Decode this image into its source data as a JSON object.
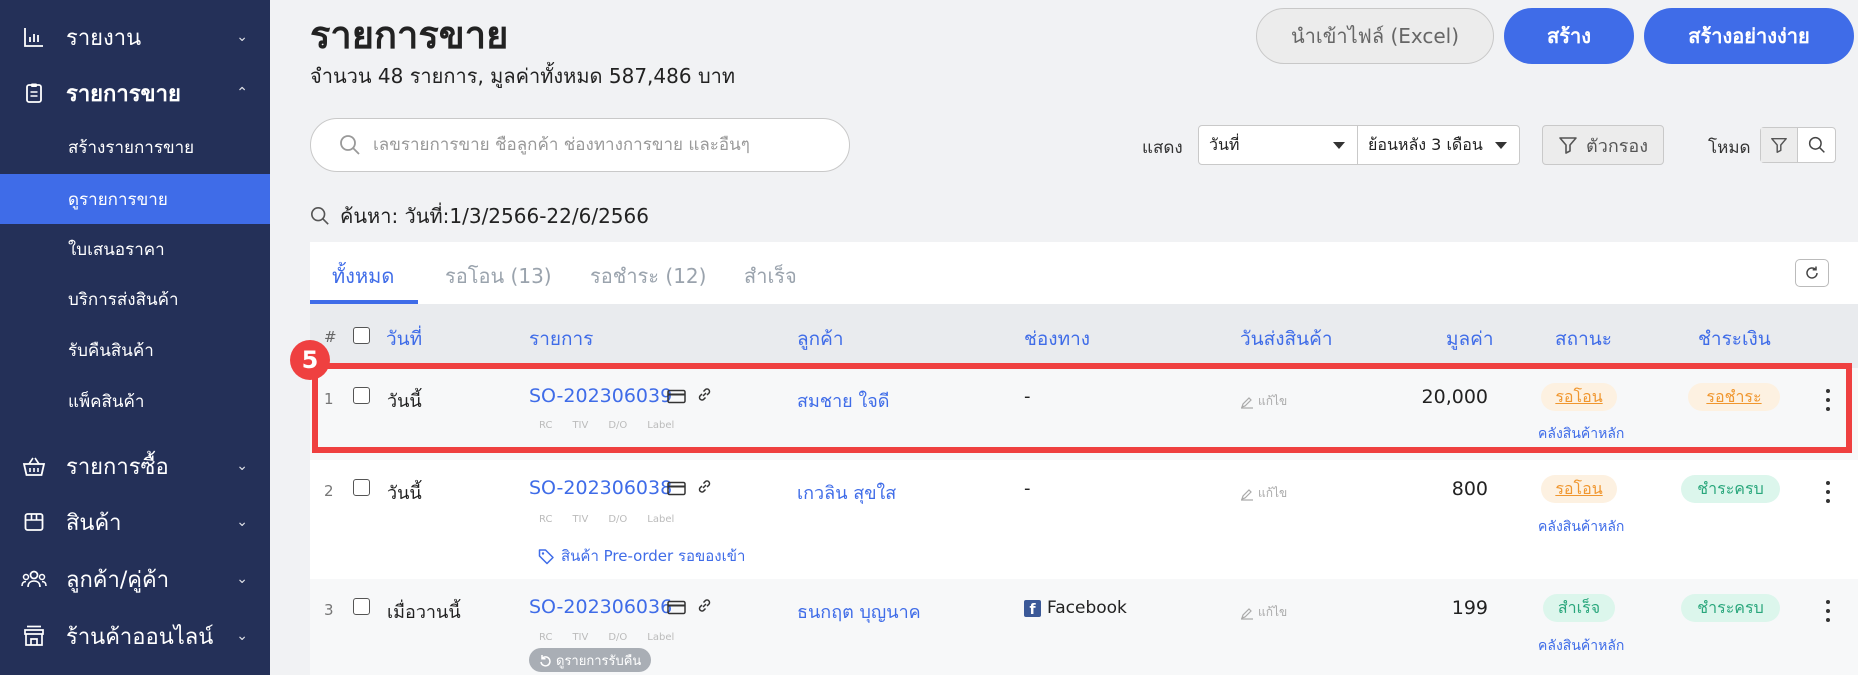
{
  "sidebar": {
    "items": [
      {
        "label": "รายงาน",
        "icon": "chart-bar-icon",
        "chevron": "⌄"
      },
      {
        "label": "รายการขาย",
        "icon": "clipboard-icon",
        "chevron": "⌃"
      },
      {
        "label": "รายการซื้อ",
        "icon": "basket-icon",
        "chevron": "⌄"
      },
      {
        "label": "สินค้า",
        "icon": "box-icon",
        "chevron": "⌄"
      },
      {
        "label": "ลูกค้า/คู่ค้า",
        "icon": "users-icon",
        "chevron": "⌄"
      },
      {
        "label": "ร้านค้าออนไลน์",
        "icon": "store-icon",
        "chevron": "⌄"
      }
    ],
    "sub_items": [
      {
        "label": "สร้างรายการขาย"
      },
      {
        "label": "ดูรายการขาย"
      },
      {
        "label": "ใบเสนอราคา"
      },
      {
        "label": "บริการส่งสินค้า"
      },
      {
        "label": "รับคืนสินค้า"
      },
      {
        "label": "แพ็คสินค้า"
      }
    ]
  },
  "header": {
    "title": "รายการขาย",
    "summary": "จำนวน 48 รายการ, มูลค่าทั้งหมด 587,486 บาท",
    "import_label": "นำเข้าไฟล์ (Excel)",
    "create_label": "สร้าง",
    "simple_create_label": "สร้างอย่างง่าย"
  },
  "toolbar": {
    "search_placeholder": "เลขรายการขาย ชื่อลูกค้า ช่องทางการขาย และอื่นๆ",
    "show_label": "แสดง",
    "date_select": "วันที่",
    "range_select": "ย้อนหลัง 3 เดือน",
    "filter_label": "ตัวกรอง",
    "mode_label": "โหมด"
  },
  "search_query": "ค้นหา: วันที่:1/3/2566-22/6/2566",
  "tabs": [
    {
      "label": "ทั้งหมด"
    },
    {
      "label": "รอโอน (13)"
    },
    {
      "label": "รอชำระ (12)"
    },
    {
      "label": "สำเร็จ"
    }
  ],
  "table": {
    "headers": {
      "hash": "#",
      "date": "วันที่",
      "order": "รายการ",
      "customer": "ลูกค้า",
      "channel": "ช่องทาง",
      "ship_date": "วันส่งสินค้า",
      "amount": "มูลค่า",
      "status": "สถานะ",
      "payment": "ชำระเงิน"
    },
    "mini_tags": [
      "RC",
      "TIV",
      "D/O",
      "Label"
    ],
    "edit_label": "แก้ไข",
    "rows": [
      {
        "num": "1",
        "date": "วันนี้",
        "order_no": "SO-202306039",
        "customer": "สมชาย ใจดี",
        "channel": "-",
        "amount": "20,000",
        "status": "รอโอน",
        "warehouse": "คลังสินค้าหลัก",
        "payment": "รอชำระ"
      },
      {
        "num": "2",
        "date": "วันนี้",
        "order_no": "SO-202306038",
        "customer": "เกวลิน สุขใส",
        "channel": "-",
        "amount": "800",
        "status": "รอโอน",
        "warehouse": "คลังสินค้าหลัก",
        "payment": "ชำระครบ",
        "preorder": "สินค้า Pre-order รอของเข้า"
      },
      {
        "num": "3",
        "date": "เมื่อวานนี้",
        "order_no": "SO-202306036",
        "customer": "ธนกฤต บุญนาค",
        "channel": "Facebook",
        "amount": "199",
        "status": "สำเร็จ",
        "warehouse": "คลังสินค้าหลัก",
        "payment": "ชำระครบ",
        "return_label": "ดูรายการรับคืน"
      }
    ]
  },
  "tutorial": {
    "step": "5"
  },
  "colors": {
    "sidebar_bg": "#243058",
    "accent": "#3f6ce8",
    "highlight": "#ef4040",
    "pending": "#f0962e",
    "success": "#2aa77c"
  }
}
